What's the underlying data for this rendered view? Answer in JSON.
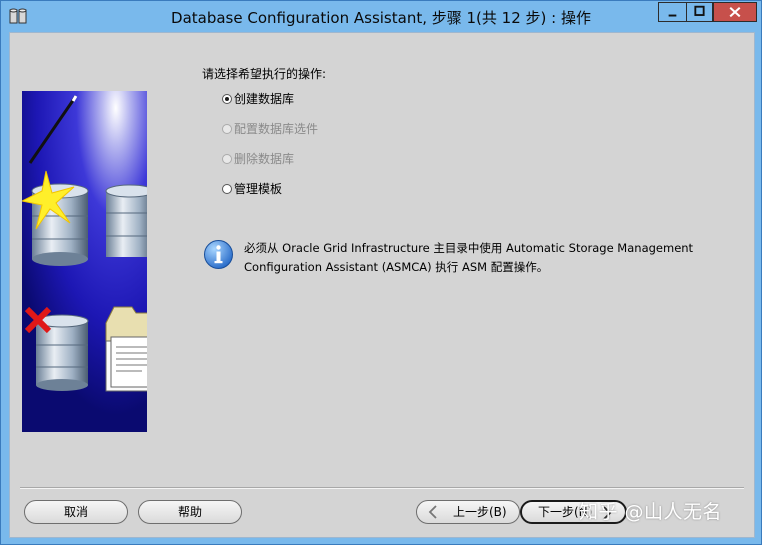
{
  "window": {
    "title": "Database Configuration Assistant, 步骤 1(共 12 步) : 操作",
    "app_icon": "database-app-icon",
    "controls": [
      "minimize-icon",
      "maximize-icon",
      "close-icon"
    ]
  },
  "main": {
    "prompt": "请选择希望执行的操作:",
    "options": [
      {
        "label": "创建数据库",
        "selected": true,
        "enabled": true
      },
      {
        "label": "配置数据库选件",
        "selected": false,
        "enabled": false
      },
      {
        "label": "删除数据库",
        "selected": false,
        "enabled": false
      },
      {
        "label": "管理模板",
        "selected": false,
        "enabled": true
      }
    ],
    "info_icon": "info-icon",
    "info_line1": "必须从 Oracle Grid Infrastructure 主目录中使用 Automatic Storage Management",
    "info_line2": "Configuration Assistant (ASMCA) 执行 ASM 配置操作。"
  },
  "buttons": {
    "cancel": "取消",
    "help": "帮助",
    "back": "上一步(B)",
    "next": "下一步(N)"
  },
  "watermark": "知乎 @山人无名",
  "colors": {
    "titlebar": "#79b9ec",
    "client_bg": "#d4d4d4",
    "close_button": "#c7504b",
    "illustration_bg": "#1a14b8"
  }
}
